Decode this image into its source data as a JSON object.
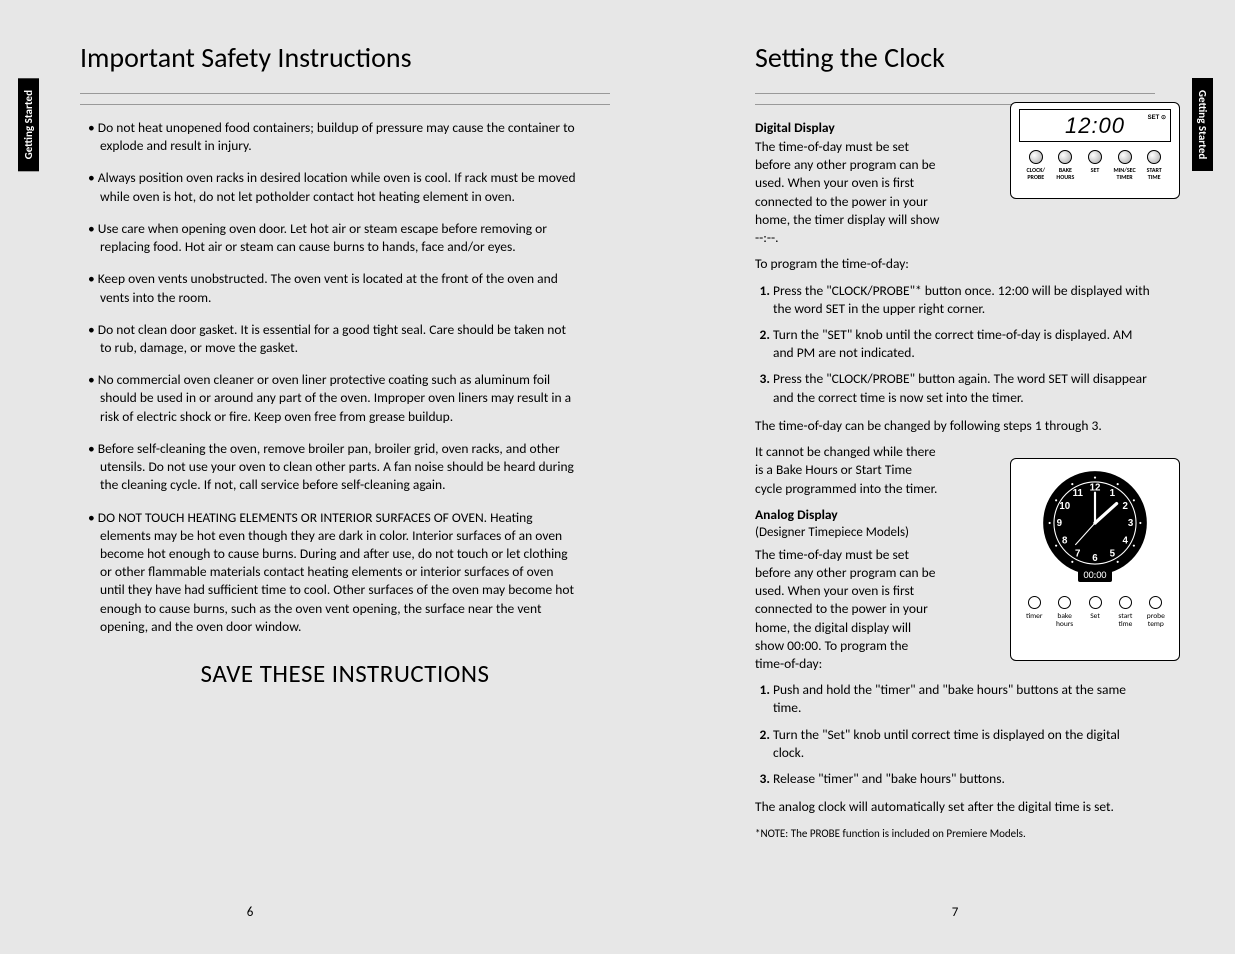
{
  "side_tab_left": "Getting Started",
  "side_tab_right": "Getting Started",
  "page_left": {
    "title": "Important Safety Instructions",
    "bullets": [
      "Do not heat unopened food containers; buildup of pressure may cause the container to explode and result in injury.",
      "Always position oven racks in desired location while oven is cool. If rack must be moved while oven is hot, do not let potholder contact hot heating element in oven.",
      "Use care when opening oven door. Let hot air or steam escape before removing or replacing food. Hot air or steam can cause burns to hands, face and/or eyes.",
      "Keep oven vents unobstructed. The oven vent is located at the front of the oven and vents into the room.",
      "Do not clean door gasket. It is essential for a good tight seal.  Care should be taken not to rub, damage, or move the gasket.",
      " No commercial oven cleaner or oven liner protective coating such as aluminum foil should be used in or around any part of the oven. Improper oven liners may result in a risk of electric shock or fire. Keep oven free from grease buildup.",
      "Before self-cleaning the oven, remove broiler pan, broiler grid, oven racks, and other utensils.  Do not use your oven to clean other parts.  A fan noise should be heard during the cleaning cycle.  If not, call service before self-cleaning again.",
      "DO NOT TOUCH HEATING ELEMENTS OR INTERIOR SURFACES OF OVEN. Heating elements may be hot even though they are dark in color. Interior surfaces of an oven become hot enough to cause burns. During and after use, do not touch or let clothing or other flammable materials contact heating elements or interior surfaces of oven until they have had sufficient time to cool. Other surfaces of the oven may become hot enough to cause burns, such as the oven vent opening, the surface near the vent opening, and the oven door window."
    ],
    "save": "SAVE THESE INSTRUCTIONS",
    "pgnum": "6"
  },
  "page_right": {
    "title": "Setting the Clock",
    "digital": {
      "heading": "Digital Display",
      "intro": "The time-of-day must be set before any other program can be used. When your oven is first connected to the power in your home, the timer display will show --:--.",
      "intro2": "To program the time-of-day:",
      "steps": [
        "Press the \"CLOCK/PROBE\"* button once.  12:00 will be displayed with the word SET in the upper right corner.",
        "Turn the \"SET\" knob until the correct time-of-day is displayed. AM and PM are not indicated.",
        "Press the \"CLOCK/PROBE\" button again.  The word SET will disappear and the correct time is now set into the timer."
      ],
      "after1": "The time-of-day can be changed by following steps 1 through 3.",
      "after2": "It cannot be changed while there is a Bake Hours or Start Time cycle programmed into the timer.",
      "lcd_time": "12:00",
      "lcd_set": "SET ⊙",
      "buttons": [
        "CLOCK/\nPROBE",
        "BAKE\nHOURS",
        "SET",
        "MIN/SEC\nTIMER",
        "START\nTIME"
      ]
    },
    "analog": {
      "heading": "Analog Display",
      "sub": "(Designer Timepiece Models)",
      "intro": "The time-of-day must be set before any other program can be used. When your oven is first connected to the power in your home, the digital display will show 00:00. To program the time-of-day:",
      "steps": [
        "Push and hold the \"timer\" and \"bake hours\" buttons at the same time.",
        "Turn the \"Set\" knob until correct time is displayed on the digital clock.",
        "Release \"timer\" and \"bake hours\" buttons."
      ],
      "after": "The analog clock will automatically set after the digital time is set.",
      "digitime": "00:00",
      "buttons": [
        "timer",
        "bake\nhours",
        "Set",
        "start\ntime",
        "probe\ntemp"
      ]
    },
    "footnote": "*NOTE: The PROBE function is included on Premiere Models.",
    "pgnum": "7"
  }
}
